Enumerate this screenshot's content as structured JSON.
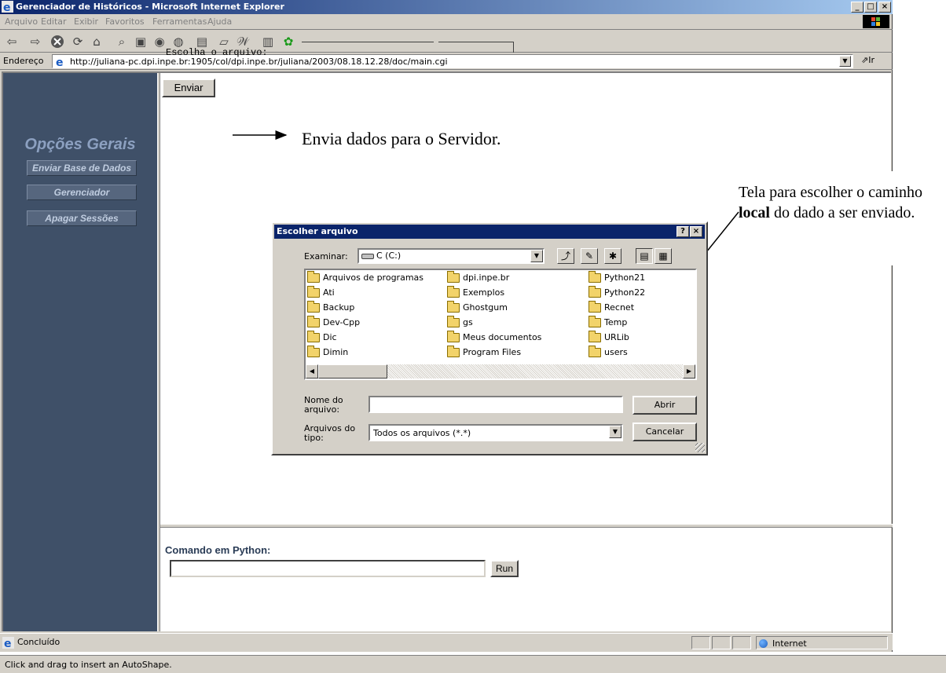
{
  "window": {
    "title": "Gerenciador de Históricos - Microsoft Internet Explorer",
    "buttons": [
      "_",
      "□",
      "×"
    ]
  },
  "menubar": {
    "items": [
      "Arquivo",
      "Editar",
      "Exibir",
      "Favoritos",
      "Ferramentas",
      "Ajuda"
    ]
  },
  "toolbar": {
    "icons": [
      "back-icon",
      "forward-icon",
      "stop-icon",
      "refresh-icon",
      "home-icon",
      "search-icon",
      "favorites-icon",
      "history-icon",
      "mail-icon",
      "print-icon",
      "edit-icon",
      "discuss-icon",
      "messenger-icon"
    ]
  },
  "address": {
    "label": "Endereço",
    "url": "http://juliana-pc.dpi.inpe.br:1905/col/dpi.inpe.br/juliana/2003/08.18.12.28/doc/main.cgi",
    "go_label": "Ir"
  },
  "sidebar": {
    "title": "Opções Gerais",
    "items": [
      "Enviar Base de Dados",
      "Gerenciador",
      "Apagar Sessões"
    ]
  },
  "main": {
    "file_label": "Escolha o arquivo:",
    "submit_label": "Enviar"
  },
  "command": {
    "label": "Comando em Python:",
    "input_value": "",
    "run_label": "Run"
  },
  "annotations": {
    "send_note": "Envia dados para o Servidor.",
    "dialog_note_pre": "Tela para escolher o caminho ",
    "dialog_note_bold": "local",
    "dialog_note_post": " do dado a ser enviado."
  },
  "dialog": {
    "title": "Escolher arquivo",
    "lookin_label": "Examinar:",
    "lookin_value": "C (C:)",
    "files": [
      "Arquivos de programas",
      "Ati",
      "Backup",
      "Dev-Cpp",
      "Dic",
      "Dimin",
      "dpi.inpe.br",
      "Exemplos",
      "Ghostgum",
      "gs",
      "Meus documentos",
      "Program Files",
      "Python21",
      "Python22",
      "Recnet",
      "Temp",
      "URLib",
      "users"
    ],
    "filename_label_1": "Nome do",
    "filename_label_2": "arquivo:",
    "filename_value": "",
    "filetype_label_1": "Arquivos do",
    "filetype_label_2": "tipo:",
    "filetype_value": "Todos os arquivos (*.*)",
    "open_label": "Abrir",
    "cancel_label": "Cancelar"
  },
  "status": {
    "text": "Concluído",
    "zone": "Internet"
  },
  "word_status": "Click and drag to insert an AutoShape."
}
